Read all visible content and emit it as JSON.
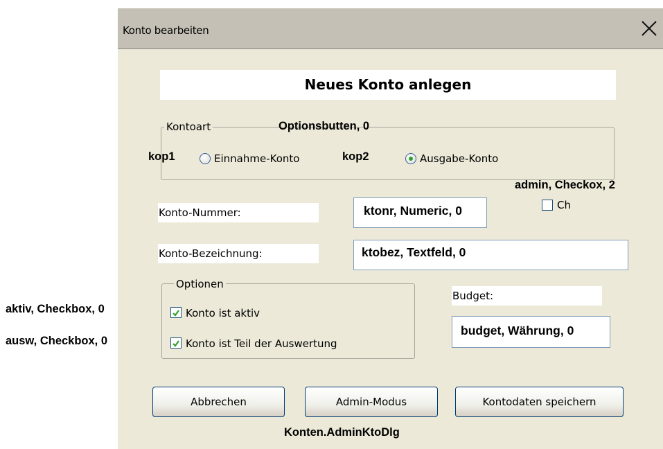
{
  "window": {
    "title": "Konto bearbeiten",
    "close_icon": "close-icon"
  },
  "heading": "Neues Konto anlegen",
  "kontoart": {
    "legend": "Kontoart",
    "annotation": "Optionsbutten, 0",
    "option1": {
      "tag": "kop1",
      "label": "Einnahme-Konto",
      "selected": false
    },
    "option2": {
      "tag": "kop2",
      "label": "Ausgabe-Konto",
      "selected": true
    }
  },
  "admin": {
    "annotation": "admin, Checkox, 2",
    "label": "Ch",
    "checked": false
  },
  "konto_nummer": {
    "label": "Konto-Nummer:",
    "field": "ktonr, Numeric, 0"
  },
  "konto_bezeichnung": {
    "label": "Konto-Bezeichnung:",
    "field": "ktobez, Textfeld, 0"
  },
  "optionen": {
    "legend": "Optionen",
    "aktiv": {
      "annotation": "aktiv, Checkbox, 0",
      "label": "Konto ist aktiv",
      "checked": true
    },
    "ausw": {
      "annotation": "ausw, Checkbox, 0",
      "label": "Konto ist Teil der Auswertung",
      "checked": true
    }
  },
  "budget": {
    "label": "Budget:",
    "field": "budget, Währung, 0"
  },
  "buttons": {
    "cancel": "Abbrechen",
    "admin_mode": "Admin-Modus",
    "save": "Kontodaten speichern"
  },
  "footer_annotation": "Konten.AdminKtoDlg",
  "colors": {
    "dialog_bg": "#ece9d8",
    "titlebar_bg": "#c4c0b5",
    "check_green": "#2ea02e",
    "field_border": "#7f9db9"
  }
}
